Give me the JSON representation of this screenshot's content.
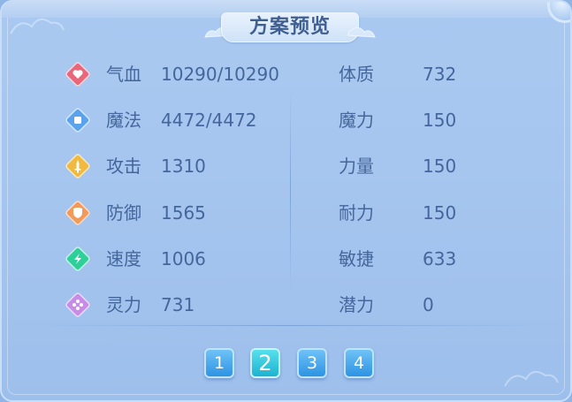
{
  "title": "方案预览",
  "stats": [
    {
      "icon": "heart-icon",
      "label": "气血",
      "value": "10290/10290",
      "color": "#e8677a"
    },
    {
      "icon": "magic-icon",
      "label": "魔法",
      "value": "4472/4472",
      "color": "#5aa3ec"
    },
    {
      "icon": "sword-icon",
      "label": "攻击",
      "value": "1310",
      "color": "#f0b940"
    },
    {
      "icon": "shield-icon",
      "label": "防御",
      "value": "1565",
      "color": "#f29a5a"
    },
    {
      "icon": "lightning-icon",
      "label": "速度",
      "value": "1006",
      "color": "#2fcf9a"
    },
    {
      "icon": "spirit-icon",
      "label": "灵力",
      "value": "731",
      "color": "#c78de6"
    }
  ],
  "attributes": [
    {
      "label": "体质",
      "value": "732"
    },
    {
      "label": "魔力",
      "value": "150"
    },
    {
      "label": "力量",
      "value": "150"
    },
    {
      "label": "耐力",
      "value": "150"
    },
    {
      "label": "敏捷",
      "value": "633"
    },
    {
      "label": "潜力",
      "value": "0"
    }
  ],
  "pages": [
    "1",
    "2",
    "3",
    "4"
  ],
  "active_page": "2"
}
